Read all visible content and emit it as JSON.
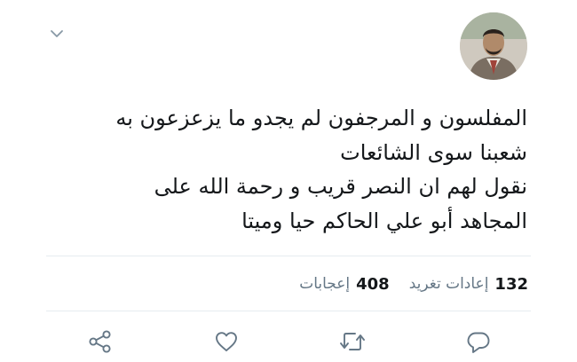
{
  "tweet": {
    "caret_icon": "chevron-down-icon",
    "avatar_icon": "avatar",
    "text_lines": [
      "المفلسون و المرجفون لم يجدو ما يزعزعون به",
      "شعبنا سوى الشائعات",
      "نقول لهم ان النصر قريب و رحمة الله على",
      "المجاهد أبو علي الحاكم حيا وميتا"
    ]
  },
  "stats": {
    "retweets": {
      "count": "132",
      "label": "إعادات تغريد"
    },
    "likes": {
      "count": "408",
      "label": "إعجابات"
    }
  },
  "actions": {
    "reply_icon": "reply-icon",
    "retweet_icon": "retweet-icon",
    "like_icon": "like-icon",
    "share_icon": "share-icon"
  },
  "colors": {
    "text": "#14171a",
    "secondary": "#657786",
    "divider": "#e6ecf0",
    "background": "#ffffff"
  }
}
